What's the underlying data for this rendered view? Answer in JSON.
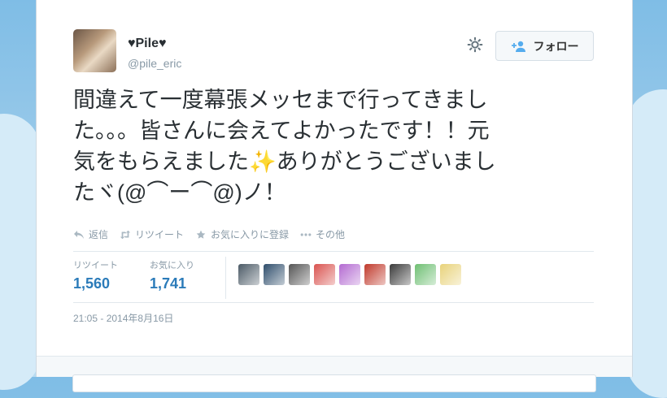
{
  "user": {
    "name": "♥Pile♥",
    "handle": "@pile_eric"
  },
  "follow_button": {
    "label": "フォロー"
  },
  "tweet": {
    "lines": [
      "間違えて一度幕張メッセまで行ってきまし",
      "た。。。皆さんに会えてよかったです！！元",
      "気をもらえました✨ありがとうございまし",
      "たヾ(@⌒ー⌒@)ノ！"
    ]
  },
  "actions": [
    {
      "label": "返信",
      "icon": "reply-icon"
    },
    {
      "label": "リツイート",
      "icon": "retweet-icon"
    },
    {
      "label": "お気に入りに登録",
      "icon": "star-icon"
    },
    {
      "label": "その他",
      "icon": "more-icon"
    }
  ],
  "stats": {
    "retweets": {
      "label": "リツイート",
      "value": "1,560"
    },
    "favorites": {
      "label": "お気に入り",
      "value": "1,741"
    }
  },
  "favoriter_avatar_colors": [
    "#4b5a66",
    "#2e4d6b",
    "#555555",
    "#d9534f",
    "#b36ad1",
    "#c0392b",
    "#3a3a3a",
    "#6fbf73",
    "#e8d27a"
  ],
  "timestamp": "21:05 - 2014年8月16日",
  "colors": {
    "accent": "#2b7bb9",
    "muted": "#8899a6",
    "text": "#292f33",
    "background": "#9ccbea"
  }
}
